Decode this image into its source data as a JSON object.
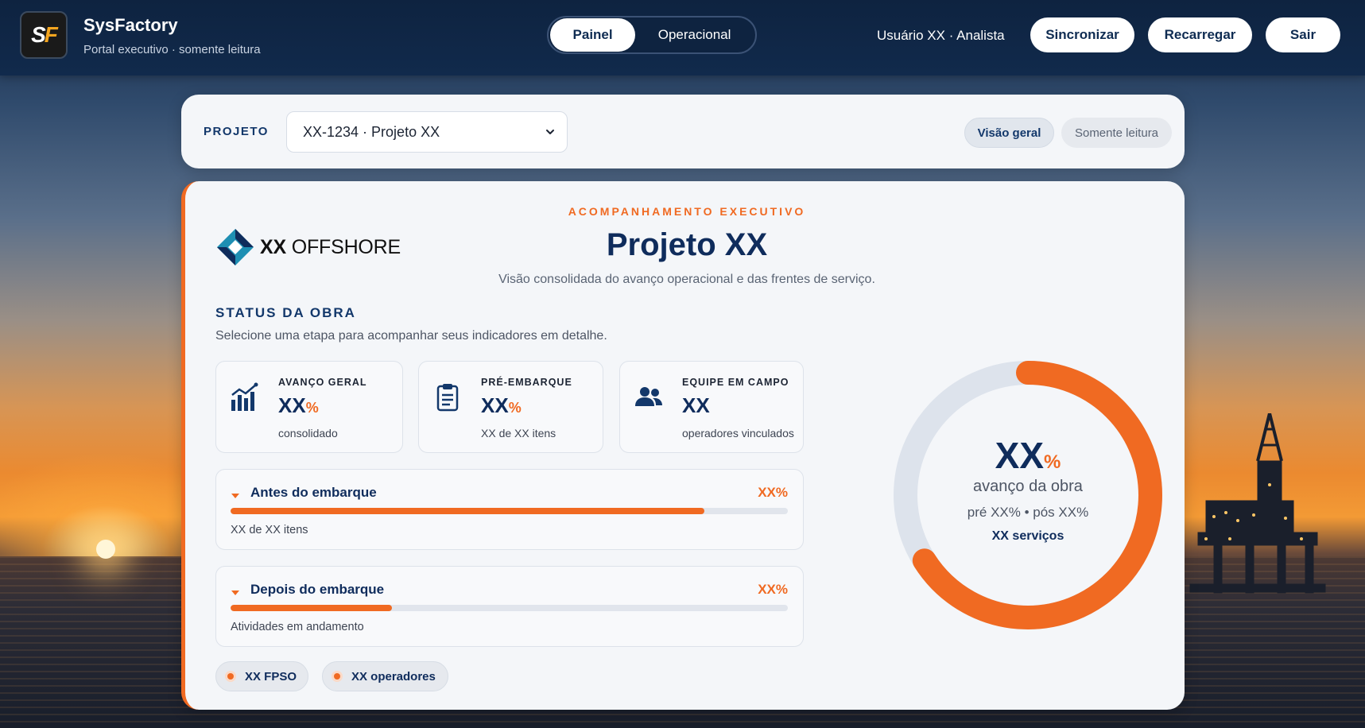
{
  "header": {
    "app_title": "SysFactory",
    "app_subtitle": "Portal executivo · somente leitura",
    "logo_text_s": "S",
    "logo_text_f": "F",
    "tabs": [
      {
        "label": "Painel",
        "active": true
      },
      {
        "label": "Operacional",
        "active": false
      }
    ],
    "user_label": "Usuário XX · Analista",
    "buttons": {
      "sync": "Sincronizar",
      "reload": "Recarregar",
      "logout": "Sair"
    }
  },
  "project_bar": {
    "label": "PROJETO",
    "selected": "XX-1234 · Projeto XX",
    "pills": {
      "overview": "Visão geral",
      "readonly": "Somente leitura"
    }
  },
  "main": {
    "eyebrow": "ACOMPANHAMENTO EXECUTIVO",
    "title": "Projeto XX",
    "subtitle": "Visão consolidada do avanço operacional e das frentes de serviço.",
    "brand": {
      "bold": "XX",
      "regular": "OFFSHORE"
    },
    "section_title": "STATUS DA OBRA",
    "section_desc": "Selecione uma etapa para acompanhar seus indicadores em detalhe.",
    "kpis": [
      {
        "label": "AVANÇO GERAL",
        "value": "XX",
        "unit": "%",
        "sub": "consolidado",
        "icon": "bar-chart-icon"
      },
      {
        "label": "PRÉ-EMBARQUE",
        "value": "XX",
        "unit": "%",
        "sub": "XX de XX itens",
        "icon": "clipboard-icon"
      },
      {
        "label": "EQUIPE EM CAMPO",
        "value": "XX",
        "unit": "",
        "sub": "operadores vinculados",
        "icon": "team-icon"
      }
    ],
    "stages": [
      {
        "name": "Antes do embarque",
        "percent_label": "XX%",
        "progress": 0.85,
        "desc": "XX de XX itens"
      },
      {
        "name": "Depois do embarque",
        "percent_label": "XX%",
        "progress": 0.29,
        "desc": "Atividades em andamento"
      }
    ],
    "chips": [
      {
        "label": "XX FPSO"
      },
      {
        "label": "XX operadores"
      }
    ],
    "donut": {
      "value": "XX",
      "unit": "%",
      "label": "avanço da obra",
      "sub": "pré XX% • pós XX%",
      "services": "XX serviços",
      "progress": 0.66
    }
  },
  "colors": {
    "accent": "#f06a22",
    "navy": "#0f2c5c",
    "header_bg": "#0e2340",
    "track": "#dfe5ee"
  }
}
